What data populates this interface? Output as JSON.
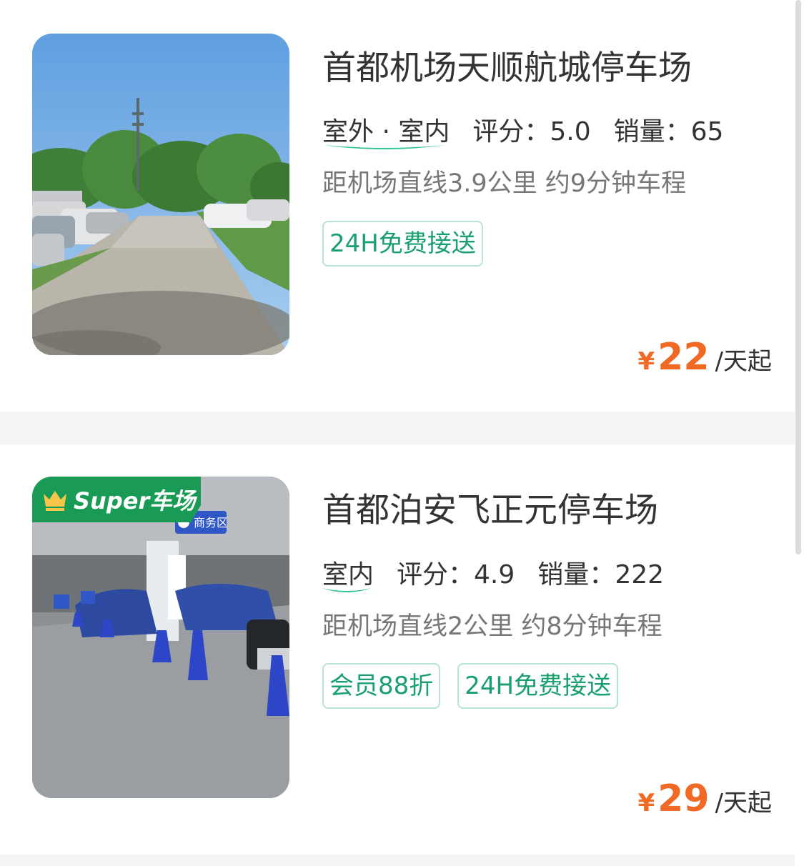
{
  "listings": [
    {
      "name": "首都机场天顺航城停车场",
      "type": "室外 · 室内",
      "rating_label": "评分：",
      "rating": "5.0",
      "sales_label": "销量：",
      "sales": "65",
      "distance": "距机场直线3.9公里 约9分钟车程",
      "tags": [
        "24H免费接送"
      ],
      "currency": "¥",
      "price": "22",
      "price_unit": "/天起",
      "badge": ""
    },
    {
      "name": "首都泊安飞正元停车场",
      "type": "室内",
      "rating_label": "评分：",
      "rating": "4.9",
      "sales_label": "销量：",
      "sales": "222",
      "distance": "距机场直线2公里 约8分钟车程",
      "tags": [
        "会员88折",
        "24H免费接送"
      ],
      "currency": "¥",
      "price": "29",
      "price_unit": "/天起",
      "badge": "Super车场",
      "photo_sign": "商务区"
    }
  ],
  "colors": {
    "accent_price": "#f06a26",
    "tag_green": "#1aa06e",
    "tag_border": "#b8e4d3",
    "badge_green": "#1a9b55",
    "crown_gold": "#f5c64a"
  }
}
